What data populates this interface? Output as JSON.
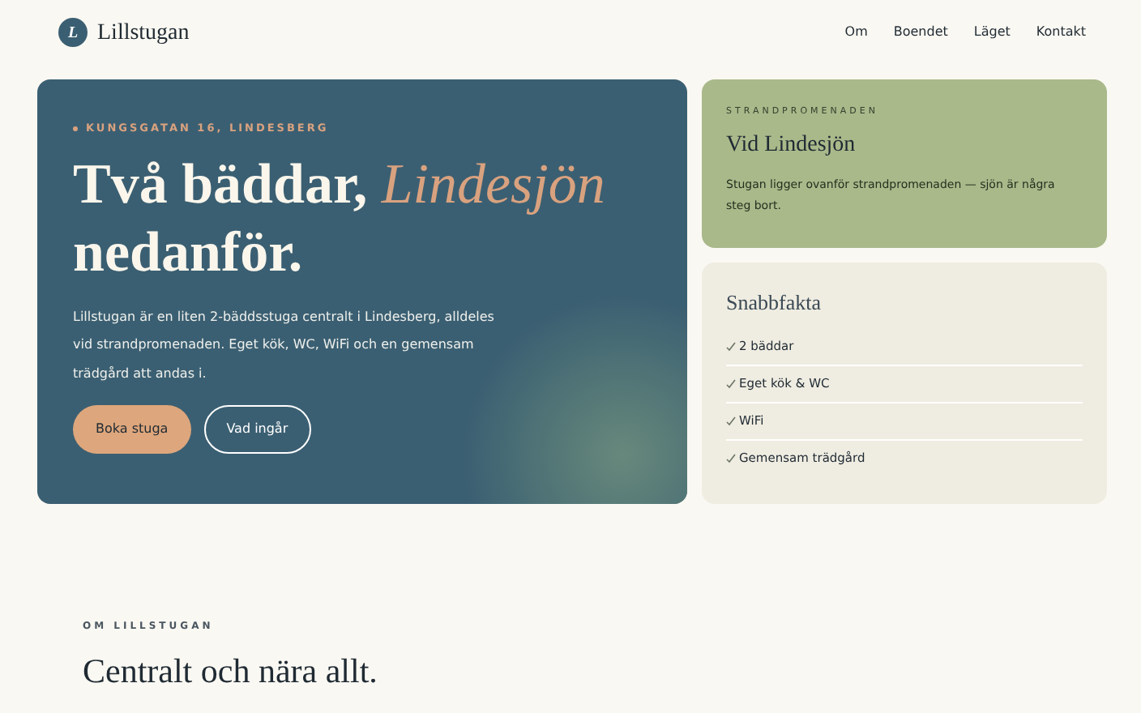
{
  "header": {
    "logo_letter": "L",
    "brand": "Lillstugan",
    "nav": [
      "Om",
      "Boendet",
      "Läget",
      "Kontakt"
    ]
  },
  "hero": {
    "eyebrow": "KUNGSGATAN 16, LINDESBERG",
    "heading_line_1": "Två bäddar, *Lindesjön*",
    "heading_line_2": "nedanför.",
    "text": "Lillstugan är en liten 2-bäddsstuga centralt i Lindesberg, alldeles vid strandpromenaden. Eget kök, WC, WiFi och en gemensam trädgård att andas i.",
    "buttons": [
      {
        "label": "Boka stuga",
        "kind": "primary"
      },
      {
        "label": "Vad ingår",
        "kind": "outline"
      }
    ]
  },
  "lake_card": {
    "eyebrow": "STRANDPROMENADEN",
    "title": "Vid Lindesjön",
    "text": "Stugan ligger ovanför strandpromenaden — sjön är några steg bort."
  },
  "facts": {
    "title": "Snabbfakta",
    "items": [
      "2 bäddar",
      "Eget kök & WC",
      "WiFi",
      "Gemensam trädgård"
    ]
  },
  "about": {
    "eyebrow": "OM LILLSTUGAN",
    "heading": "Centralt och nära allt."
  }
}
